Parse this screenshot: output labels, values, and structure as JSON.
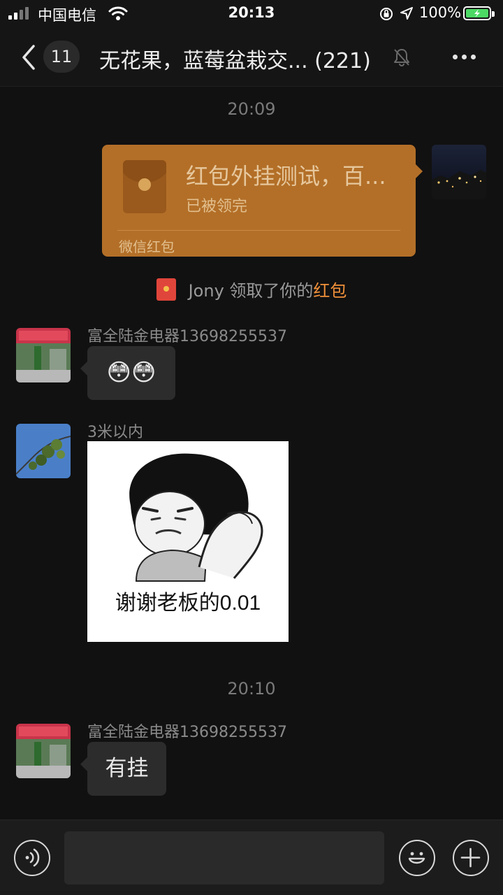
{
  "status_bar": {
    "carrier": "中国电信",
    "time": "20:13",
    "battery": "100%"
  },
  "nav": {
    "unread_count": "11",
    "title": "无花果，蓝莓盆栽交... (221)"
  },
  "messages": {
    "time_1": "20:09",
    "red_packet": {
      "title": "红包外挂测试，百...",
      "status": "已被领完",
      "footer": "微信红包"
    },
    "system": {
      "prefix": "Jony 领取了你的",
      "highlight": "红包"
    },
    "msg_1": {
      "sender": "富全陆金电器13698255537",
      "content": "😳😳"
    },
    "msg_2": {
      "sender": "3米以内",
      "sticker_caption": "谢谢老板的0.01"
    },
    "time_2": "20:10",
    "msg_3": {
      "sender": "富全陆金电器13698255537",
      "content": "有挂"
    }
  },
  "input": {
    "placeholder": ""
  },
  "colors": {
    "background": "#111111",
    "red_packet": "#b36f28",
    "highlight": "#f0913a",
    "bubble": "#2c2c2c"
  }
}
